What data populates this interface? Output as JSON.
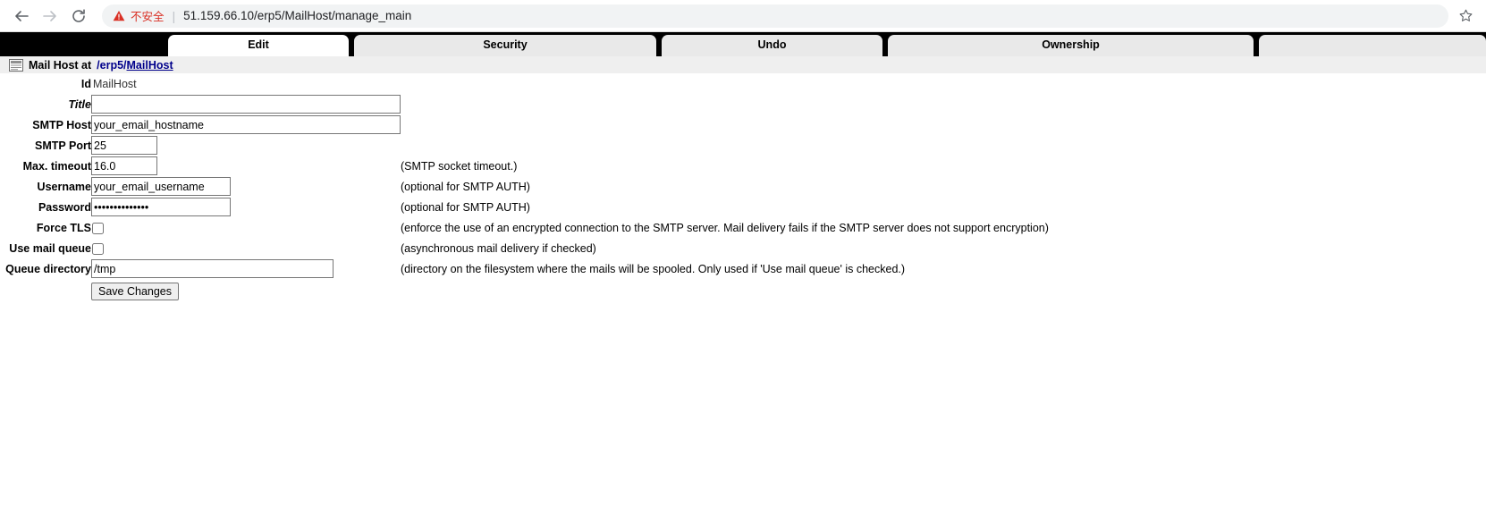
{
  "browser": {
    "back_label": "Back",
    "forward_label": "Forward",
    "reload_label": "Reload",
    "security_label": "不安全",
    "separator": "|",
    "url": "51.159.66.10/erp5/MailHost/manage_main",
    "bookmark_label": "Bookmark this page",
    "warning_color": "#d93025"
  },
  "tabs": [
    {
      "label": "Edit",
      "active": true
    },
    {
      "label": "Security",
      "active": false
    },
    {
      "label": "Undo",
      "active": false
    },
    {
      "label": "Ownership",
      "active": false
    },
    {
      "label": "",
      "active": false
    }
  ],
  "object_header": {
    "title": "Mail Host at",
    "path_prefix": "/erp5/",
    "path_name": "MailHost"
  },
  "form": {
    "rows": [
      {
        "label": "Id",
        "type": "static",
        "value": "MailHost",
        "help": ""
      },
      {
        "label": "Title",
        "type": "text",
        "value": "",
        "optional": true,
        "help": ""
      },
      {
        "label": "SMTP Host",
        "type": "text",
        "value": "your_email_hostname",
        "help": ""
      },
      {
        "label": "SMTP Port",
        "type": "text",
        "value": "25",
        "help": ""
      },
      {
        "label": "Max. timeout",
        "type": "text",
        "value": "16.0",
        "help": "(SMTP socket timeout.)"
      },
      {
        "label": "Username",
        "type": "text",
        "value": "your_email_username",
        "help": "(optional for SMTP AUTH)"
      },
      {
        "label": "Password",
        "type": "password",
        "value": "••••••••••••••",
        "help": "(optional for SMTP AUTH)"
      },
      {
        "label": "Force TLS",
        "type": "checkbox",
        "checked": false,
        "help": "(enforce the use of an encrypted connection to the SMTP server. Mail delivery fails if the SMTP server does not support encryption)"
      },
      {
        "label": "Use mail queue",
        "type": "checkbox",
        "checked": false,
        "help": "(asynchronous mail delivery if checked)"
      },
      {
        "label": "Queue directory",
        "type": "text",
        "value": "/tmp",
        "help": "(directory on the filesystem where the mails will be spooled. Only used if 'Use mail queue' is checked.)"
      }
    ],
    "save_label": "Save Changes"
  }
}
